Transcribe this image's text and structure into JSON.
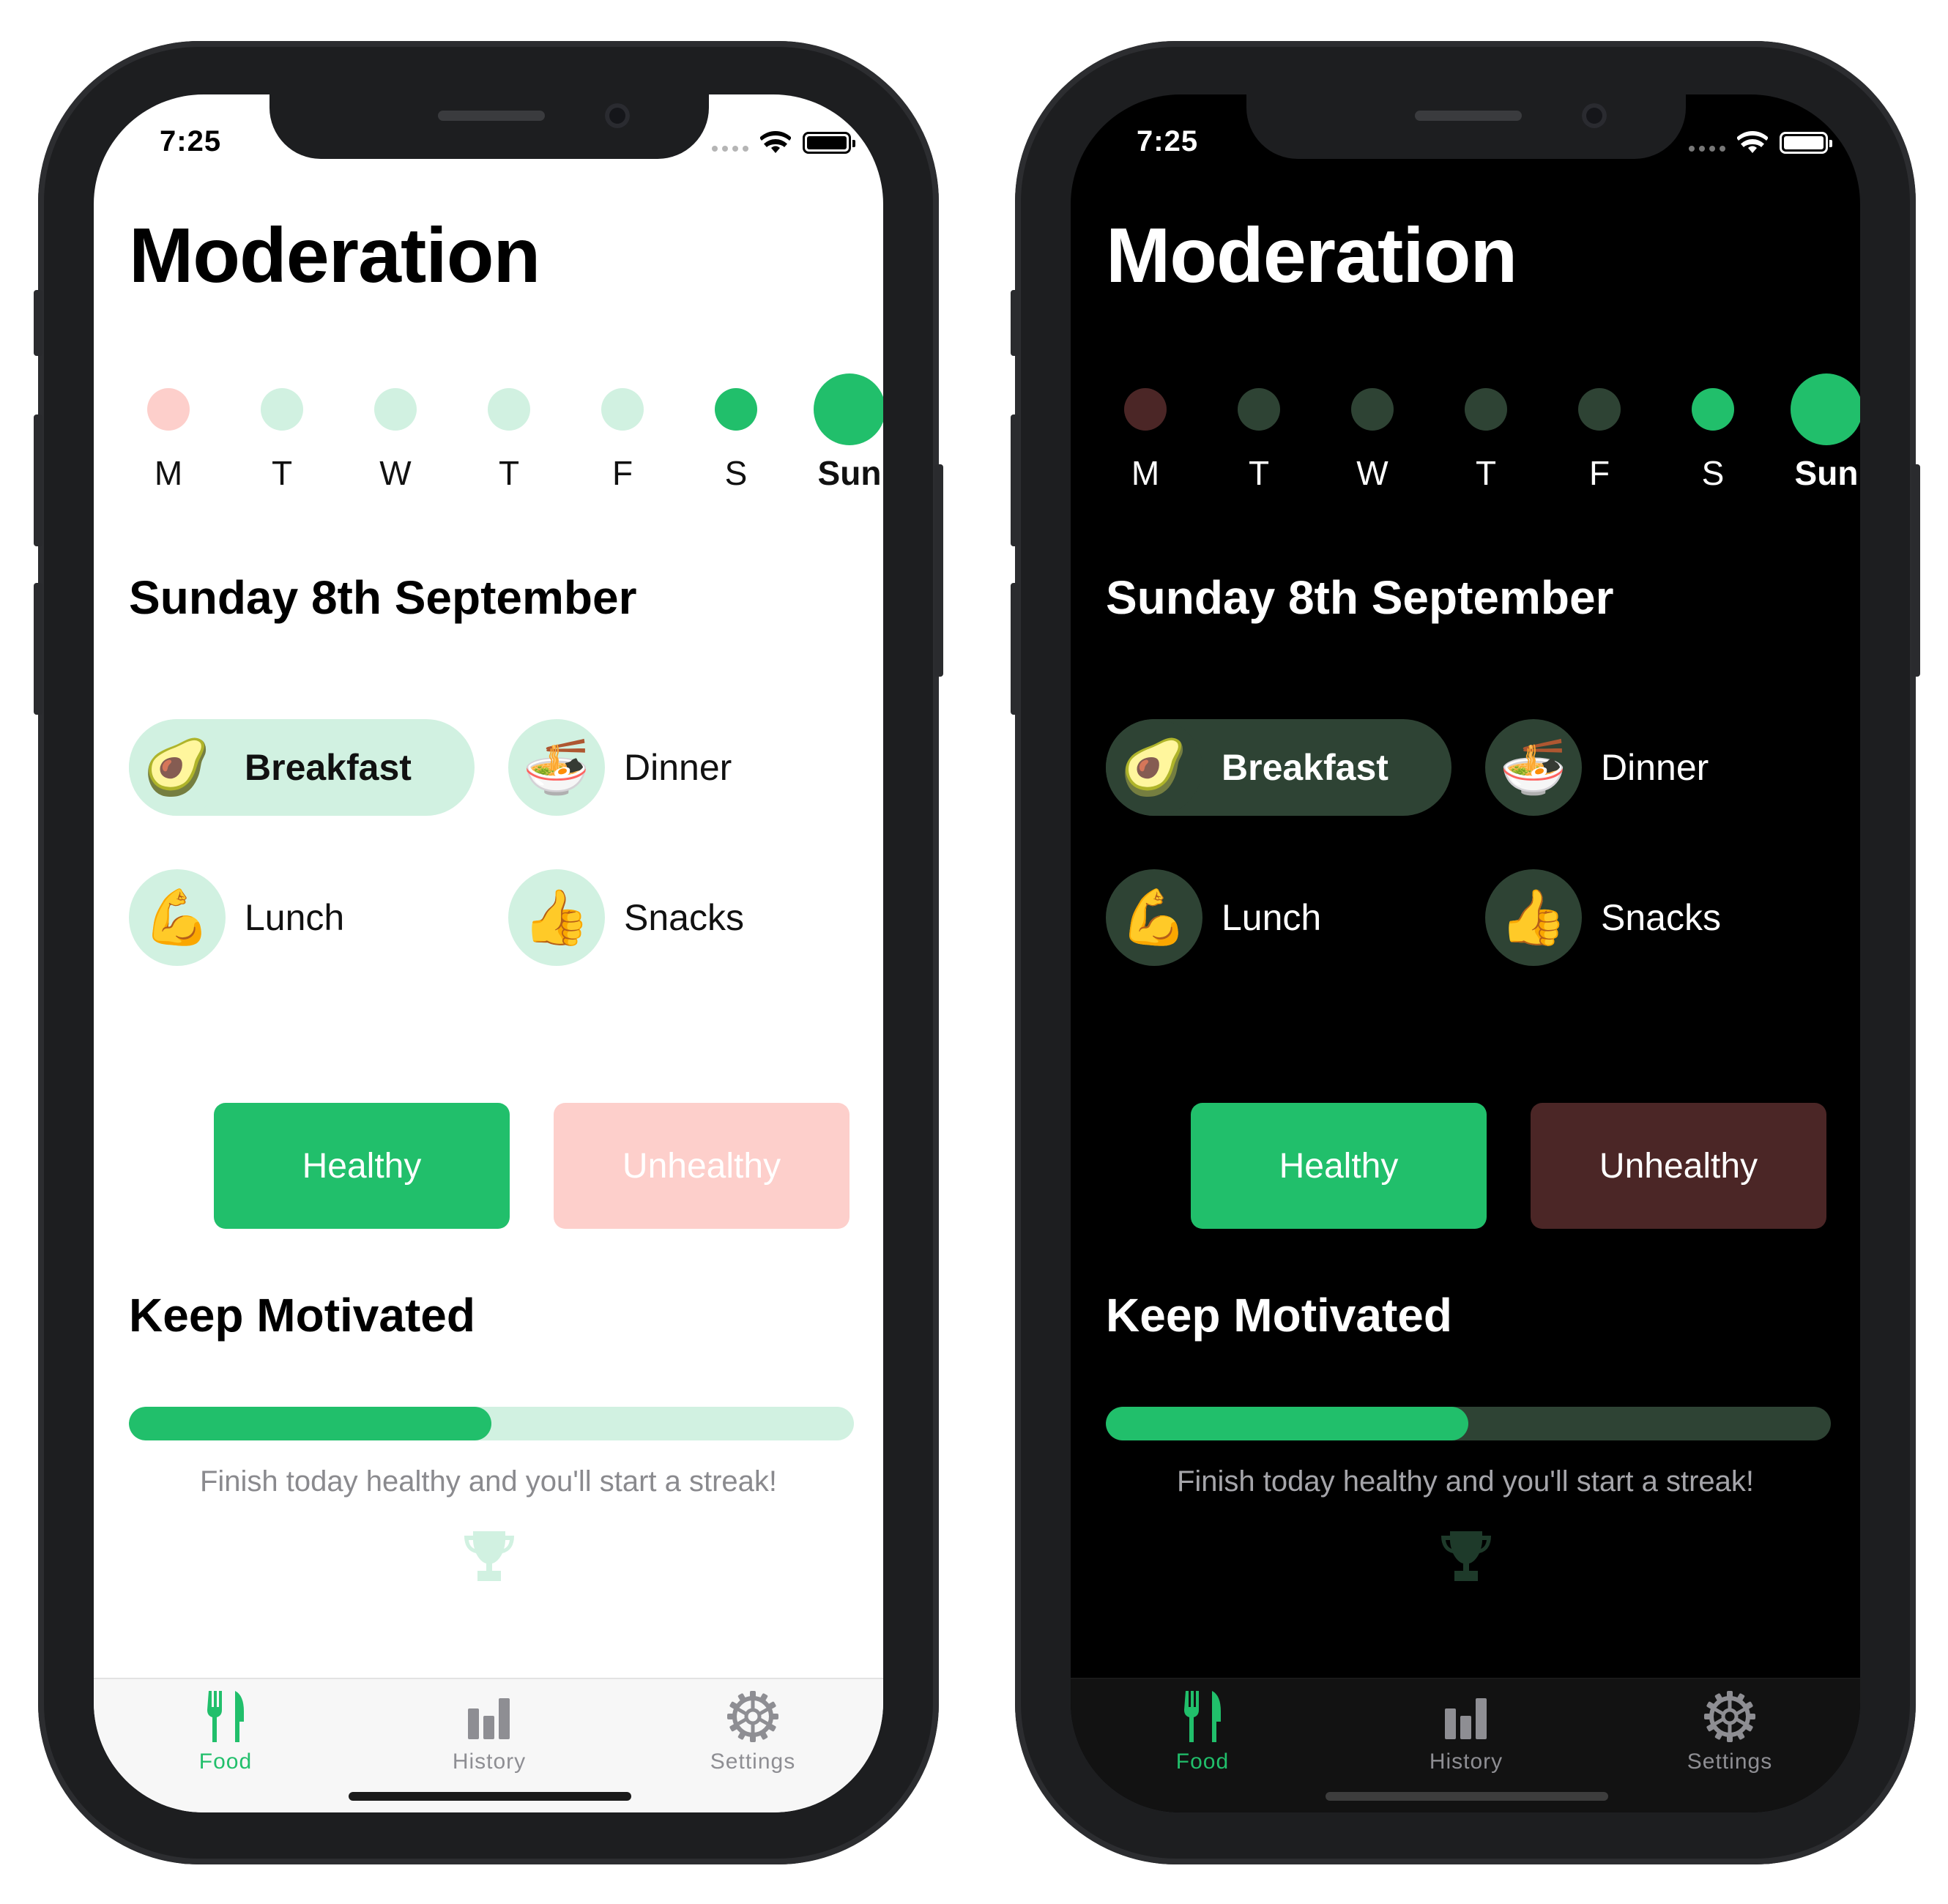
{
  "screens": [
    {
      "theme": "light",
      "status": {
        "time": "7:25"
      },
      "title": "Moderation",
      "week": [
        {
          "label": "M",
          "status": "unhealthy",
          "color": "#fdcfcb"
        },
        {
          "label": "T",
          "status": "none",
          "color": "#d1f1e1"
        },
        {
          "label": "W",
          "status": "none",
          "color": "#d1f1e1"
        },
        {
          "label": "T",
          "status": "none",
          "color": "#d1f1e1"
        },
        {
          "label": "F",
          "status": "none",
          "color": "#d1f1e1"
        },
        {
          "label": "S",
          "status": "healthy",
          "color": "#21bf6b"
        },
        {
          "label": "Sun",
          "status": "today",
          "color": "#21bf6b"
        }
      ],
      "date_heading": "Sunday 8th September",
      "meals": [
        {
          "label": "Breakfast",
          "emoji": "🥑",
          "icon": "avocado-icon",
          "selected": true
        },
        {
          "label": "Dinner",
          "emoji": "🍜",
          "icon": "bowl-icon",
          "selected": false
        },
        {
          "label": "Lunch",
          "emoji": "💪",
          "icon": "flexed-biceps-icon",
          "selected": false
        },
        {
          "label": "Snacks",
          "emoji": "👍",
          "icon": "thumbs-up-icon",
          "selected": false
        }
      ],
      "buttons": {
        "healthy": "Healthy",
        "unhealthy": "Unhealthy"
      },
      "motivation": {
        "heading": "Keep Motivated",
        "progress": 0.5,
        "message": "Finish today healthy and you'll start a streak!"
      },
      "tabs": [
        {
          "label": "Food",
          "icon": "fork-knife-icon",
          "active": true
        },
        {
          "label": "History",
          "icon": "bar-chart-icon",
          "active": false
        },
        {
          "label": "Settings",
          "icon": "gear-icon",
          "active": false
        }
      ],
      "colors": {
        "accent": "#21bf6b",
        "accent_soft": "#d1f1e1",
        "unhealthy": "#fdcfcb",
        "unhealthy_text": "#ffffff",
        "trophy": "#d1f1e1",
        "inactive_tab": "#8e8e93"
      }
    },
    {
      "theme": "dark",
      "status": {
        "time": "7:25"
      },
      "title": "Moderation",
      "week": [
        {
          "label": "M",
          "status": "unhealthy",
          "color": "#4b2626"
        },
        {
          "label": "T",
          "status": "none",
          "color": "#2e4334"
        },
        {
          "label": "W",
          "status": "none",
          "color": "#2e4334"
        },
        {
          "label": "T",
          "status": "none",
          "color": "#2e4334"
        },
        {
          "label": "F",
          "status": "none",
          "color": "#2e4334"
        },
        {
          "label": "S",
          "status": "healthy",
          "color": "#21bf6b"
        },
        {
          "label": "Sun",
          "status": "today",
          "color": "#21bf6b"
        }
      ],
      "date_heading": "Sunday 8th September",
      "meals": [
        {
          "label": "Breakfast",
          "emoji": "🥑",
          "icon": "avocado-icon",
          "selected": true
        },
        {
          "label": "Dinner",
          "emoji": "🍜",
          "icon": "bowl-icon",
          "selected": false
        },
        {
          "label": "Lunch",
          "emoji": "💪",
          "icon": "flexed-biceps-icon",
          "selected": false
        },
        {
          "label": "Snacks",
          "emoji": "👍",
          "icon": "thumbs-up-icon",
          "selected": false
        }
      ],
      "buttons": {
        "healthy": "Healthy",
        "unhealthy": "Unhealthy"
      },
      "motivation": {
        "heading": "Keep Motivated",
        "progress": 0.5,
        "message": "Finish today healthy and you'll start a streak!"
      },
      "tabs": [
        {
          "label": "Food",
          "icon": "fork-knife-icon",
          "active": true
        },
        {
          "label": "History",
          "icon": "bar-chart-icon",
          "active": false
        },
        {
          "label": "Settings",
          "icon": "gear-icon",
          "active": false
        }
      ],
      "colors": {
        "accent": "#21bf6b",
        "accent_soft": "#2e4334",
        "unhealthy": "#4b2626",
        "unhealthy_text": "#ffffff",
        "trophy": "#1e3a2a",
        "inactive_tab": "#8e8e93"
      }
    }
  ]
}
